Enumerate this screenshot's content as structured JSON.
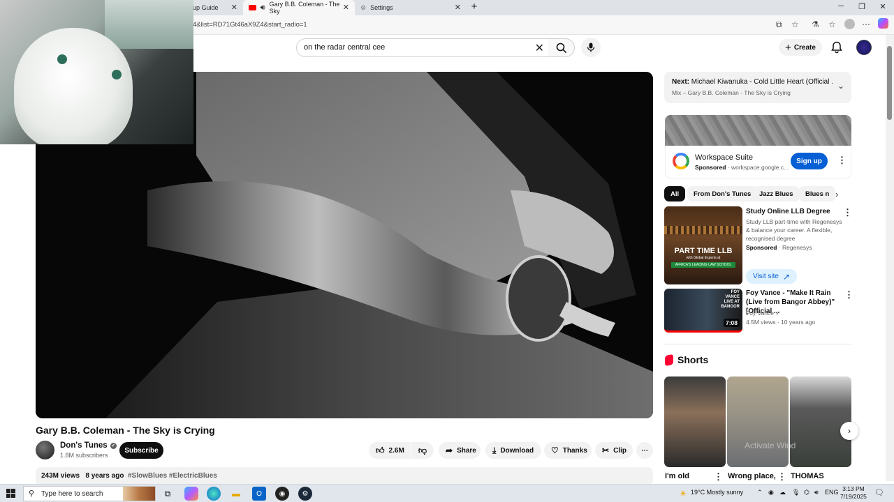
{
  "browser": {
    "tabs": [
      {
        "label": "up Guide"
      },
      {
        "label": "Gary B.B. Coleman - The Sky"
      },
      {
        "label": "Settings"
      }
    ],
    "new_tab": "+",
    "url": "4&list=RD71Gt46aX9Z4&start_radio=1"
  },
  "header": {
    "search_query": "on the radar central cee",
    "create_label": "Create"
  },
  "video": {
    "title": "Gary B.B. Coleman - The Sky is Crying",
    "channel": "Don's Tunes",
    "subscribers": "1.8M subscribers",
    "subscribe_label": "Subscribe",
    "likes": "2.6M",
    "share_label": "Share",
    "download_label": "Download",
    "thanks_label": "Thanks",
    "clip_label": "Clip",
    "views": "243M views",
    "age": "8 years ago",
    "tags": "#SlowBlues #ElectricBlues"
  },
  "next": {
    "prefix": "Next:",
    "title": "Michael Kiwanuka - Cold Little Heart (Official ...",
    "subtitle": "Mix – Gary B.B. Coleman - The Sky is Crying"
  },
  "ad": {
    "title": "Workspace Suite",
    "sponsored": "Sponsored",
    "domain": "· workspace.google.c...",
    "cta": "Sign up"
  },
  "chips": [
    "All",
    "From Don's Tunes",
    "Jazz Blues",
    "Blues n"
  ],
  "recs": [
    {
      "title": "Study Online LLB Degree",
      "desc": "Study LLB part-time with Regenesys & balance your career. A flexible, recognised degree",
      "sponsored": "Sponsored",
      "advertiser": "· Regenesys",
      "cta": "Visit site",
      "thumb_text1": "PART TIME LLB",
      "thumb_text2": "with Global Experts at",
      "thumb_text3": "AFRICA'S LEADING LAW SCHOOL"
    },
    {
      "title": "Foy Vance - \"Make It Rain (Live from Bangor Abbey)\" [Official ...",
      "channel": "Foy Vance",
      "meta": "4.5M views · 10 years ago",
      "duration": "7:08",
      "thumb_text": "FOY VANCE LIVE AT BANGOR"
    }
  ],
  "shorts": {
    "heading": "Shorts",
    "items": [
      {
        "title": "I'm old"
      },
      {
        "title": "Wrong place,"
      },
      {
        "title": "THOMAS"
      }
    ],
    "watermark": "Activate Wind"
  },
  "taskbar": {
    "search_placeholder": "Type here to search",
    "weather": "19°C  Mostly sunny",
    "lang": "ENG",
    "time": "3:13 PM",
    "date": "7/19/2025"
  }
}
